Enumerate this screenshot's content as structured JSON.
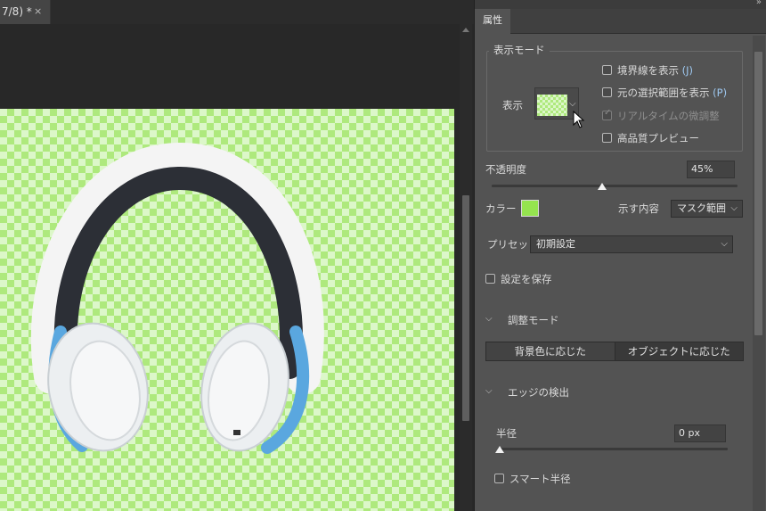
{
  "document": {
    "tab_label": "7/8) *",
    "close_glyph": "×"
  },
  "panel": {
    "tab_label": "属性",
    "display_mode": {
      "legend": "表示モード",
      "view_label": "表示",
      "options": [
        {
          "label": "境界線を表示",
          "shortcut": "(J)",
          "checked": false,
          "disabled": false
        },
        {
          "label": "元の選択範囲を表示",
          "shortcut": "(P)",
          "checked": false,
          "disabled": false
        },
        {
          "label": "リアルタイムの微調整",
          "shortcut": "",
          "checked": true,
          "disabled": true
        },
        {
          "label": "高品質プレビュー",
          "shortcut": "",
          "checked": false,
          "disabled": false
        }
      ]
    },
    "opacity": {
      "label": "不透明度",
      "value": "45%",
      "level": 0.45
    },
    "color": {
      "label": "カラー",
      "swatch": "#95e44f"
    },
    "show_content": {
      "label": "示す内容",
      "value": "マスク範囲"
    },
    "preset": {
      "label": "プリセット",
      "value": "初期設定"
    },
    "save_settings": {
      "label": "設定を保存",
      "checked": false
    },
    "adjust_mode": {
      "title": "調整モード",
      "buttons": [
        "背景色に応じた",
        "オブジェクトに応じた"
      ]
    },
    "edge_detection": {
      "title": "エッジの検出",
      "radius_label": "半径",
      "radius_value": "0 px",
      "smart_radius_label": "スマート半径",
      "smart_radius_checked": false
    }
  },
  "colors": {
    "checker_light": "#dcf7c9",
    "checker_dark": "#aee97d",
    "panel_bg": "#535353",
    "accent_shortcut": "#9ec8f0"
  }
}
